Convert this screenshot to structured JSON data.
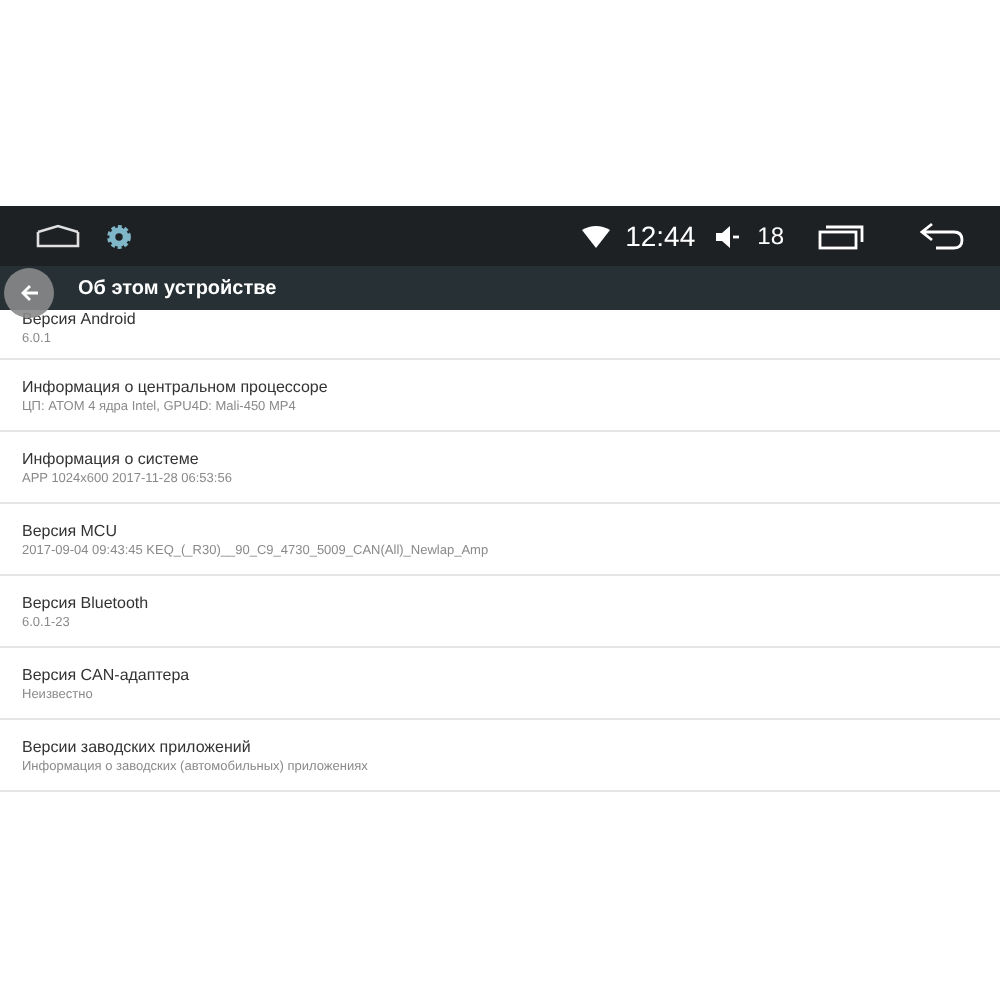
{
  "status_bar": {
    "time": "12:44",
    "volume": "18"
  },
  "toolbar": {
    "title": "Об этом устройстве"
  },
  "items": [
    {
      "title": "Версия Android",
      "value": "6.0.1"
    },
    {
      "title": "Информация о центральном процессоре",
      "value": "ЦП: ATOM 4 ядра Intel, GPU4D: Mali-450 MP4"
    },
    {
      "title": "Информация о системе",
      "value": "APP 1024x600 2017-11-28 06:53:56"
    },
    {
      "title": "Версия MCU",
      "value": "2017-09-04 09:43:45 KEQ_(_R30)__90_C9_4730_5009_CAN(All)_Newlap_Amp"
    },
    {
      "title": "Версия Bluetooth",
      "value": "6.0.1-23"
    },
    {
      "title": "Версия CAN-адаптера",
      "value": "Неизвестно"
    },
    {
      "title": "Версии заводских приложений",
      "value": "Информация о заводских (автомобильных) приложениях"
    }
  ]
}
